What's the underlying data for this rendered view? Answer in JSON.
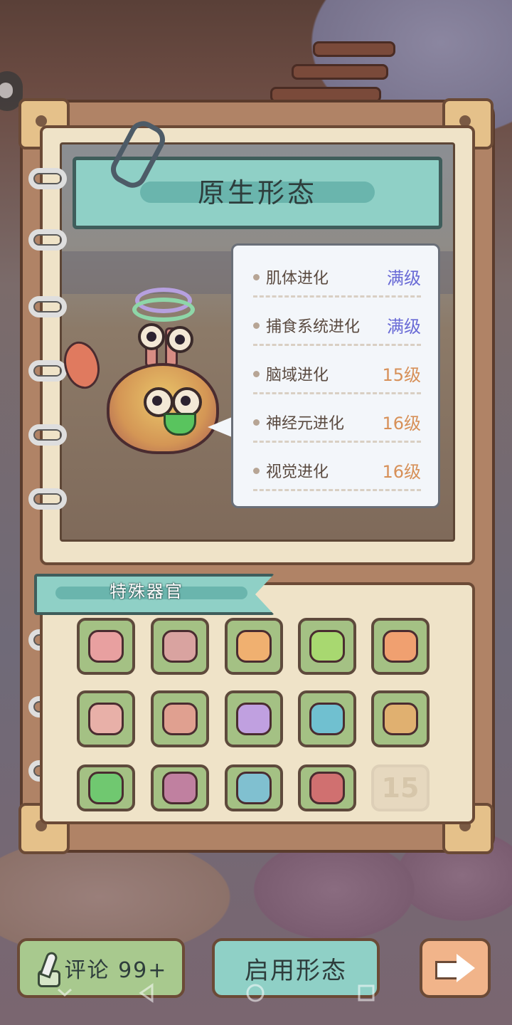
{
  "title": "原生形态",
  "evolution_stats": [
    {
      "name": "肌体进化",
      "value": "满级",
      "color": "#6a6bd6"
    },
    {
      "name": "捕食系统进化",
      "value": "满级",
      "color": "#6a6bd6"
    },
    {
      "name": "脑域进化",
      "value": "15级",
      "color": "#d79058"
    },
    {
      "name": "神经元进化",
      "value": "16级",
      "color": "#d79058"
    },
    {
      "name": "视觉进化",
      "value": "16级",
      "color": "#d79058"
    }
  ],
  "special_organs": {
    "label": "特殊器官",
    "items": [
      {
        "icon": "fanged-mouth-icon",
        "color": "#e8a0a0"
      },
      {
        "icon": "skin-patch-icon",
        "color": "#d9a3a0"
      },
      {
        "icon": "brain-icon",
        "color": "#f0b070"
      },
      {
        "icon": "eyeball-stalk-icon",
        "color": "#a8d870"
      },
      {
        "icon": "neuron-icon",
        "color": "#f0a070"
      },
      {
        "icon": "tusked-mouth-icon",
        "color": "#e8b0a8"
      },
      {
        "icon": "striped-hide-icon",
        "color": "#e0a090"
      },
      {
        "icon": "brain-icon",
        "color": "#c0a0e0"
      },
      {
        "icon": "eyeball-stalk-icon",
        "color": "#70c0d0"
      },
      {
        "icon": "spinal-organ-icon",
        "color": "#e0b070"
      },
      {
        "icon": "spore-cluster-icon",
        "color": "#70c870"
      },
      {
        "icon": "horns-icon",
        "color": "#c080a0"
      },
      {
        "icon": "brain-icon",
        "color": "#80c0d0"
      },
      {
        "icon": "eyeball-stalk-icon",
        "color": "#d07070"
      }
    ],
    "locked_slot_label": "15"
  },
  "buttons": {
    "comment": "评论 99+",
    "use_form": "启用形态"
  }
}
